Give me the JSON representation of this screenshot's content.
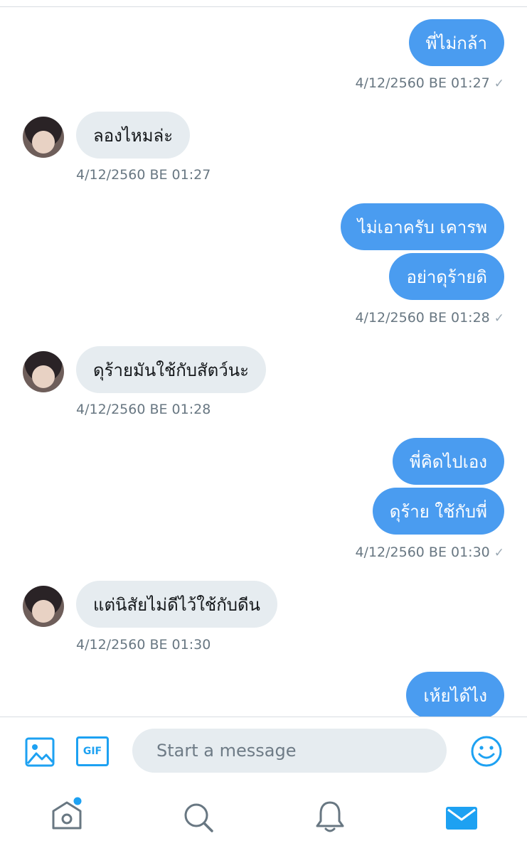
{
  "messages": [
    {
      "dir": "sent",
      "text": "พี่ไม่กล้า"
    },
    {
      "dir": "recv",
      "text": "ลองไหมล่ะ"
    },
    {
      "dir": "sent",
      "text": "ไม่เอาครับ เคารพ"
    },
    {
      "dir": "sent",
      "text": "อย่าดุร้ายดิ"
    },
    {
      "dir": "recv",
      "text": "ดุร้ายมันใช้กับสัตว์นะ"
    },
    {
      "dir": "sent",
      "text": "พี่คิดไปเอง"
    },
    {
      "dir": "sent",
      "text": "ดุร้าย ใช้กับพี่"
    },
    {
      "dir": "recv",
      "text": "แต่นิสัยไม่ดีไว้ใช้กับดีน"
    },
    {
      "dir": "sent",
      "text": "เห้ยได้ไง"
    }
  ],
  "timestamps": [
    {
      "text": "4/12/2560 BE 01:27",
      "read_check": "✓"
    },
    {
      "text": "4/12/2560 BE 01:27"
    },
    {
      "text": "4/12/2560 BE 01:28",
      "read_check": "✓"
    },
    {
      "text": "4/12/2560 BE 01:28"
    },
    {
      "text": "4/12/2560 BE 01:30",
      "read_check": "✓"
    },
    {
      "text": "4/12/2560 BE 01:30"
    }
  ],
  "composer": {
    "placeholder": "Start a message",
    "gif_label": "GIF",
    "icons": [
      "image-icon",
      "gif-icon",
      "emoji-icon"
    ]
  },
  "tabbar": {
    "icons": [
      "home-icon",
      "search-icon",
      "notifications-icon",
      "messages-icon"
    ],
    "active": "messages-icon",
    "home_has_notification_dot": true
  },
  "colors": {
    "accent": "#1da1f2",
    "sent_bubble": "#4a9cf0",
    "received_bubble": "#e6ecf0",
    "timestamp_text": "#687782",
    "icon_inactive": "#687782"
  }
}
